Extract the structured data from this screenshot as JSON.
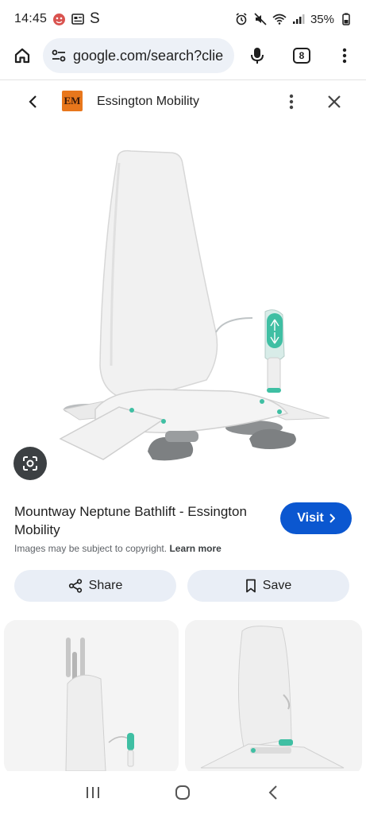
{
  "status": {
    "time": "14:45",
    "carrier_letter": "S",
    "battery": "35%"
  },
  "browser": {
    "url": "google.com/search?clie",
    "tab_count": "8"
  },
  "lens_header": {
    "logo_text": "EM",
    "site_name": "Essington Mobility"
  },
  "result": {
    "title": "Mountway Neptune Bathlift - Essington Mobility",
    "visit_label": "Visit",
    "copyright_text": "Images may be subject to copyright.",
    "learn_more": "Learn more"
  },
  "actions": {
    "share_label": "Share",
    "save_label": "Save"
  },
  "colors": {
    "accent": "#0b57d0",
    "pill": "#e9eef6",
    "teal": "#3fbfa3"
  }
}
